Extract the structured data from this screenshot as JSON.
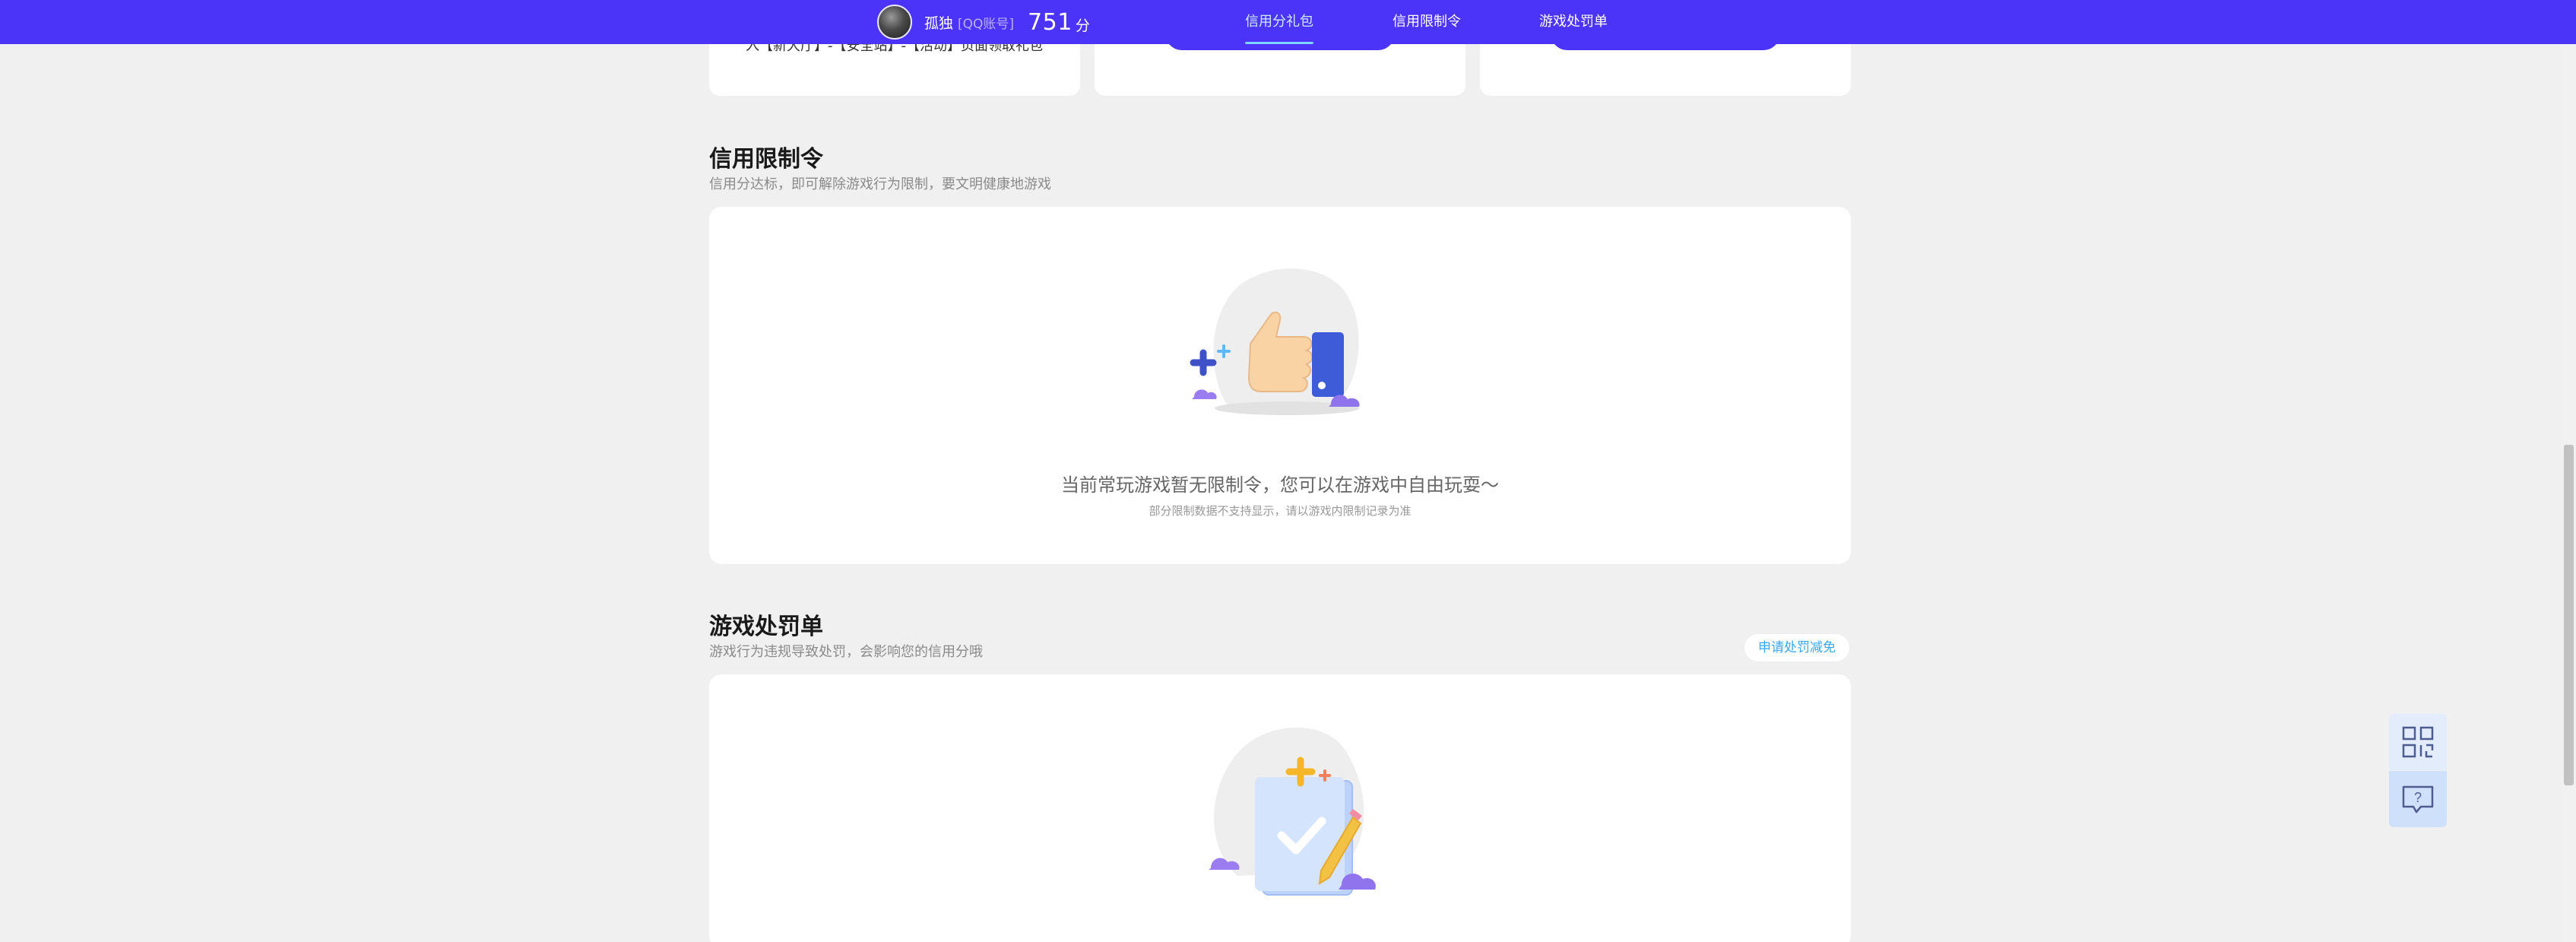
{
  "topbar": {
    "username": "孤独",
    "account_tag": "[QQ账号]",
    "score": "751",
    "score_unit": "分",
    "tabs": [
      {
        "label": "信用分礼包",
        "active": true
      },
      {
        "label": "信用限制令",
        "active": false
      },
      {
        "label": "游戏处罚单",
        "active": false
      }
    ]
  },
  "top_cards": [
    {
      "text": "入【新大厅】-【安全站】-【活动】页面领取礼包"
    },
    {
      "text": ""
    },
    {
      "text": ""
    }
  ],
  "restriction": {
    "title": "信用限制令",
    "desc": "信用分达标，即可解除游戏行为限制，要文明健康地游戏",
    "empty_main": "当前常玩游戏暂无限制令，您可以在游戏中自由玩耍～",
    "empty_sub": "部分限制数据不支持显示，请以游戏内限制记录为准"
  },
  "penalty": {
    "title": "游戏处罚单",
    "desc": "游戏行为违规导致处罚，会影响您的信用分哦",
    "appeal_label": "申请处罚减免"
  },
  "side_buttons": [
    {
      "icon": "qrcode-icon"
    },
    {
      "icon": "help-feedback-icon"
    }
  ],
  "colors": {
    "brand": "#4b34f7",
    "active_tab": "#cfeaff",
    "link": "#3aa7f5"
  }
}
